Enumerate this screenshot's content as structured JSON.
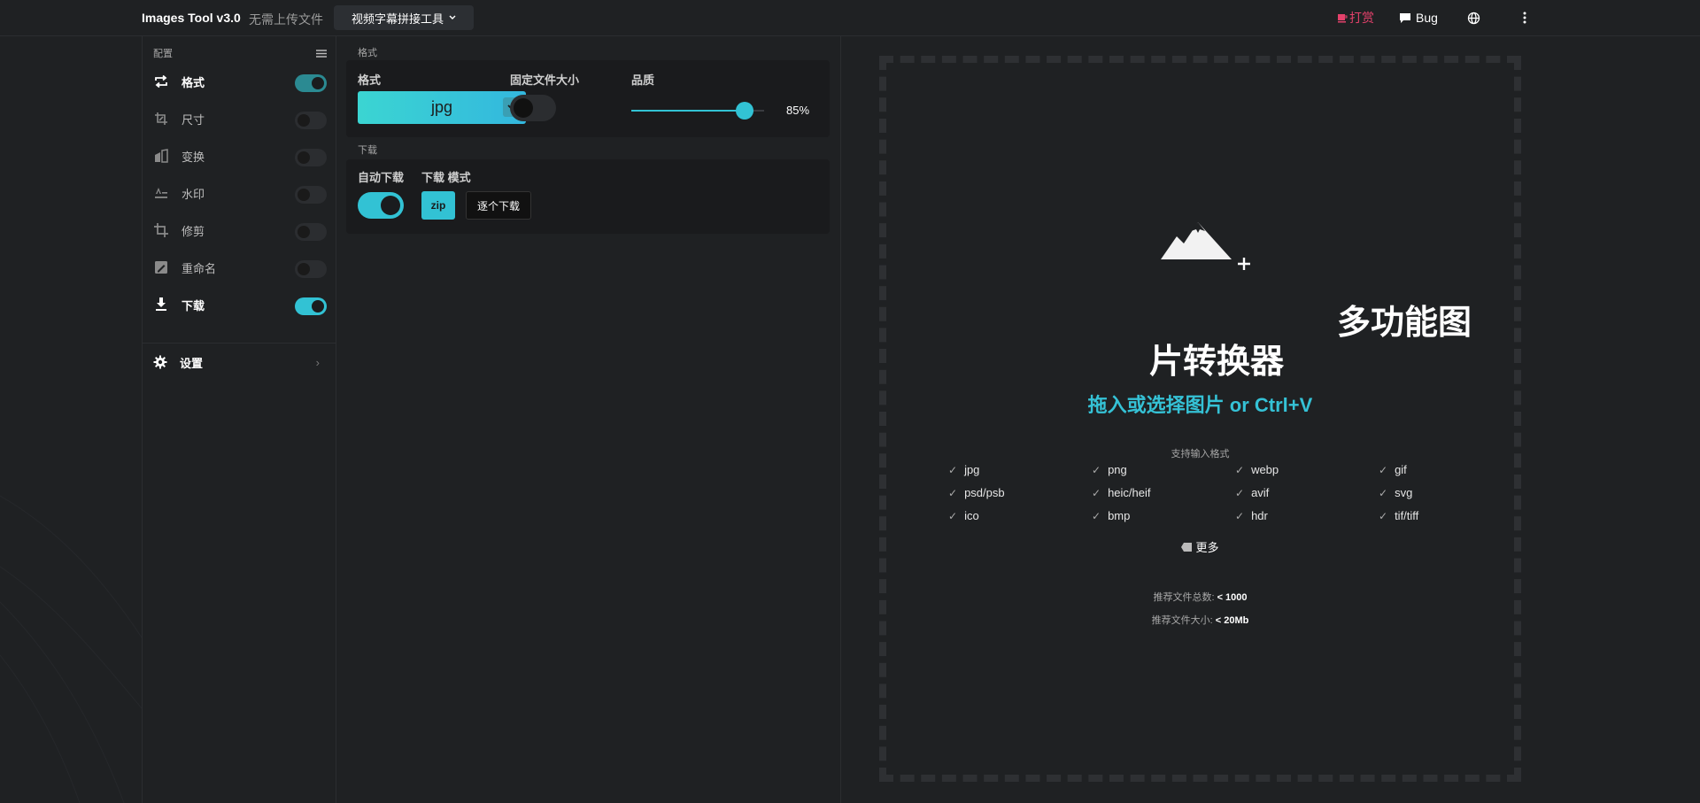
{
  "header": {
    "brand": "Images Tool v3.0",
    "subtitle": "无需上传文件",
    "tool_menu": "视频字幕拼接工具",
    "donate": "打赏",
    "bug": "Bug"
  },
  "sidebar": {
    "section": "配置",
    "items": [
      {
        "label": "格式",
        "enabled": true
      },
      {
        "label": "尺寸",
        "enabled": false
      },
      {
        "label": "变换",
        "enabled": false
      },
      {
        "label": "水印",
        "enabled": false
      },
      {
        "label": "修剪",
        "enabled": false
      },
      {
        "label": "重命名",
        "enabled": false
      },
      {
        "label": "下载",
        "enabled": true
      }
    ],
    "settings": "设置"
  },
  "format_section": {
    "title": "格式",
    "format_label": "格式",
    "format_value": "jpg",
    "fixed_size_label": "固定文件大小",
    "fixed_size_on": false,
    "quality_label": "品质",
    "quality_value": "85%",
    "quality_fraction": 0.85
  },
  "download_section": {
    "title": "下载",
    "auto_label": "自动下载",
    "auto_on": true,
    "mode_label": "下载 模式",
    "mode_zip": "zip",
    "mode_each": "逐个下载"
  },
  "dropzone": {
    "title_line1": "多功能图",
    "title_line2": "片转换器",
    "subtitle": "拖入或选择图片 or Ctrl+V",
    "supported_label": "支持输入格式",
    "formats": [
      "jpg",
      "png",
      "webp",
      "gif",
      "psd/psb",
      "heic/heif",
      "avif",
      "svg",
      "ico",
      "bmp",
      "hdr",
      "tif/tiff"
    ],
    "more": "更多",
    "count_label": "推荐文件总数:",
    "count_value": "< 1000",
    "size_label": "推荐文件大小:",
    "size_value": "< 20Mb"
  },
  "colors": {
    "accent": "#32c2d4",
    "donate": "#e4416b",
    "background": "#1f2123"
  }
}
